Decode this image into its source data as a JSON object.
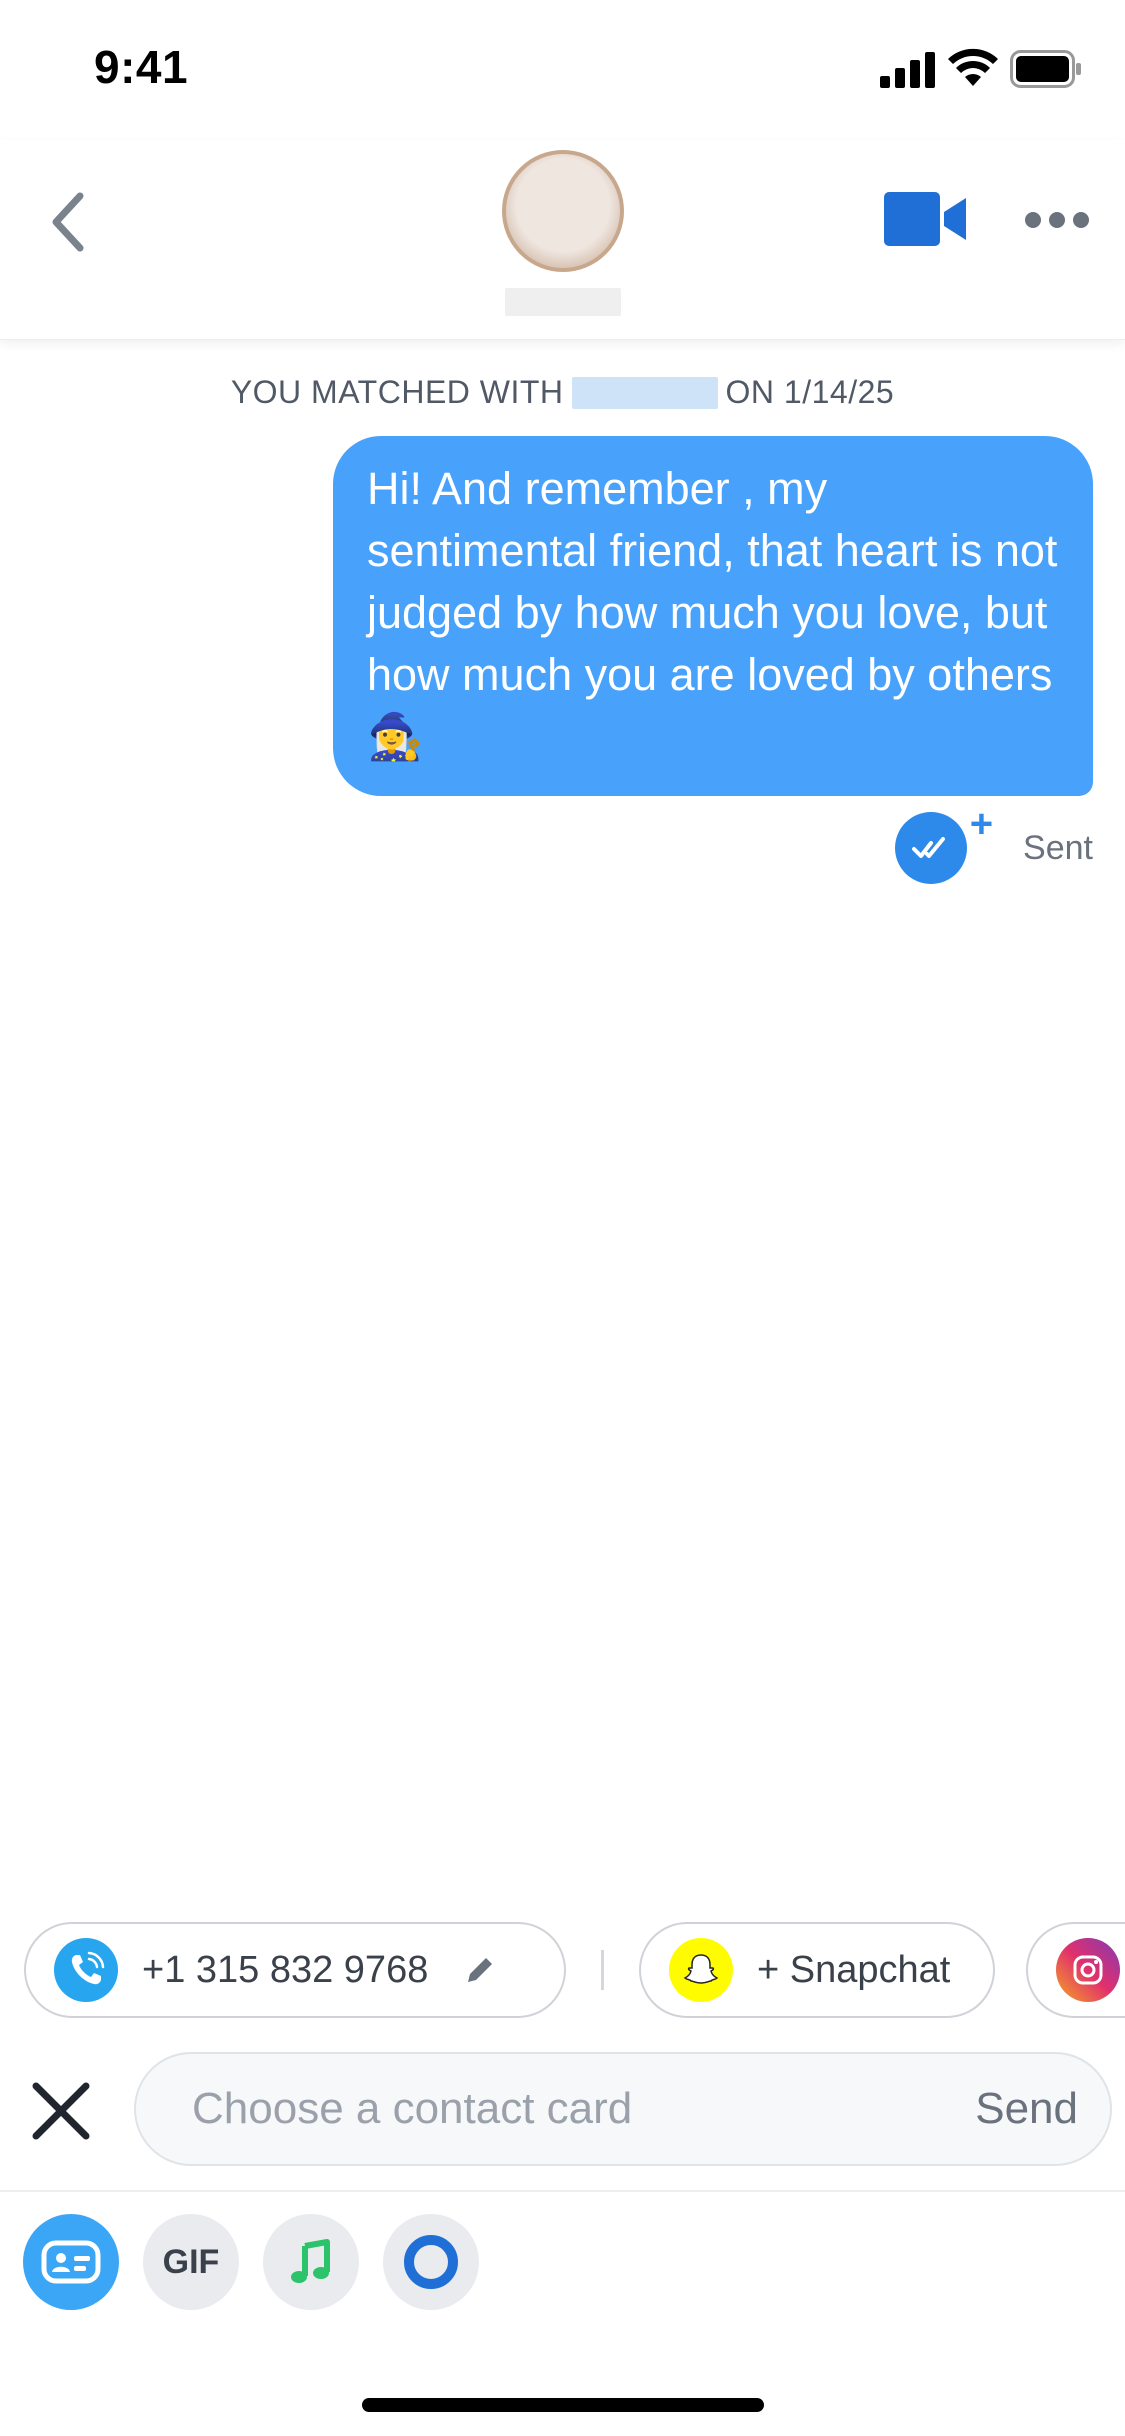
{
  "status_bar": {
    "time": "9:41"
  },
  "header": {
    "back_icon": "chevron-left-icon",
    "video_icon": "video-camera-icon",
    "more_icon": "more-dots-icon",
    "accent_color": "#1f6fd6"
  },
  "conversation": {
    "matched_prefix": "YOU MATCHED WITH",
    "matched_suffix": "ON 1/14/25",
    "message_text": "Hi! And remember , my sentimental friend, that heart is not judged by how much you love, but how much you are loved by others ",
    "message_emoji": "🧙‍♀️",
    "bubble_color": "#48a2fb",
    "status_label": "Sent",
    "read_plus": "+"
  },
  "contacts": {
    "phone": "+1 315 832 9768",
    "snapchat": "+ Snapchat",
    "phone_icon": "phone-icon",
    "snapchat_icon": "snapchat-ghost-icon",
    "instagram_icon": "instagram-icon"
  },
  "composer": {
    "placeholder": "Choose a contact card",
    "send_label": "Send"
  },
  "toolbar": {
    "gif_label": "GIF",
    "contact_card_icon": "contact-card-icon",
    "music_icon": "music-note-icon",
    "loop_icon": "ring-icon"
  }
}
